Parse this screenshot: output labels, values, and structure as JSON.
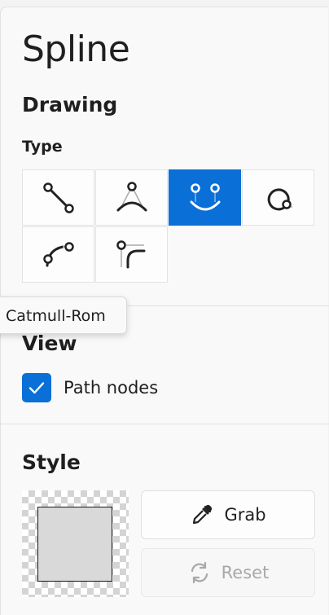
{
  "panel": {
    "title": "Spline",
    "drawing": {
      "heading": "Drawing",
      "type_label": "Type",
      "types": [
        {
          "icon": "line-segment-icon",
          "active": false
        },
        {
          "icon": "bezier-curve-icon",
          "active": false
        },
        {
          "icon": "catmull-rom-curve-icon",
          "active": true
        },
        {
          "icon": "closed-curve-icon",
          "active": false
        },
        {
          "icon": "arc-curve-icon",
          "active": false
        },
        {
          "icon": "corner-curve-icon",
          "active": false
        }
      ],
      "tooltip": "Catmull-Rom"
    },
    "view": {
      "heading": "View",
      "path_nodes_label": "Path nodes",
      "path_nodes_checked": true
    },
    "style": {
      "heading": "Style",
      "grab_label": "Grab",
      "reset_label": "Reset"
    }
  },
  "colors": {
    "accent": "#0a6fd6",
    "swatch_fill": "#d9d9d9"
  }
}
